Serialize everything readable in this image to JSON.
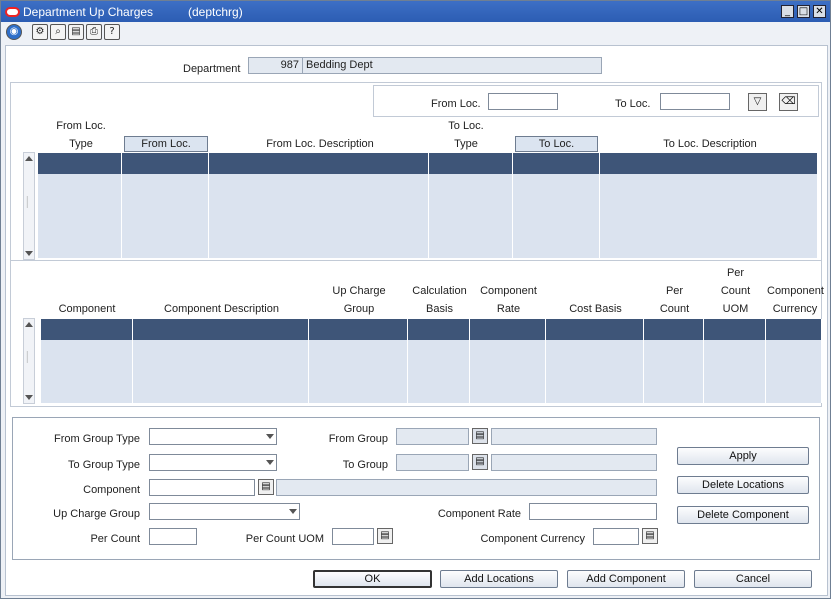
{
  "window": {
    "title": "Department Up Charges",
    "subtitle": "(deptchrg)",
    "minimize": "_",
    "restore": "□",
    "close": "✕"
  },
  "toolbar": {
    "icons": [
      "globe-icon",
      "actions-icon",
      "find-icon",
      "clipboard-icon",
      "print-icon",
      "help-icon"
    ]
  },
  "header": {
    "department_label": "Department",
    "department_id": "987",
    "department_name": "Bedding Dept"
  },
  "filter": {
    "from_loc_label": "From Loc.",
    "to_loc_label": "To Loc.",
    "from_loc_value": "",
    "to_loc_value": ""
  },
  "loc_table": {
    "col_from_type_1": "From Loc.",
    "col_from_type_2": "Type",
    "col_from_loc": "From Loc.",
    "col_from_desc": "From Loc. Description",
    "col_to_type_1": "To Loc.",
    "col_to_type_2": "Type",
    "col_to_loc": "To Loc.",
    "col_to_desc": "To Loc. Description"
  },
  "comp_table": {
    "col_component": "Component",
    "col_component_desc": "Component Description",
    "col_upcharge_1": "Up Charge",
    "col_upcharge_2": "Group",
    "col_calc_1": "Calculation",
    "col_calc_2": "Basis",
    "col_rate_1": "Component",
    "col_rate_2": "Rate",
    "col_cost_basis": "Cost Basis",
    "col_per_count_1": "Per",
    "col_per_count_2": "Count",
    "col_uom_1": "Per",
    "col_uom_2": "Count",
    "col_uom_3": "UOM",
    "col_currency_1": "Component",
    "col_currency_2": "Currency"
  },
  "form": {
    "from_group_type": "From Group Type",
    "to_group_type": "To Group Type",
    "component": "Component",
    "up_charge_group": "Up Charge Group",
    "per_count": "Per Count",
    "from_group": "From Group",
    "to_group": "To Group",
    "per_count_uom": "Per Count UOM",
    "component_rate": "Component Rate",
    "component_currency": "Component Currency"
  },
  "side_buttons": {
    "apply": "Apply",
    "delete_locations": "Delete Locations",
    "delete_component": "Delete Component"
  },
  "footer": {
    "ok": "OK",
    "add_locations": "Add Locations",
    "add_component": "Add Component",
    "cancel": "Cancel"
  },
  "colors": {
    "title_bar": "#2c5db3",
    "selected_row": "#3e5578",
    "row_fill": "#dbe3ef"
  }
}
